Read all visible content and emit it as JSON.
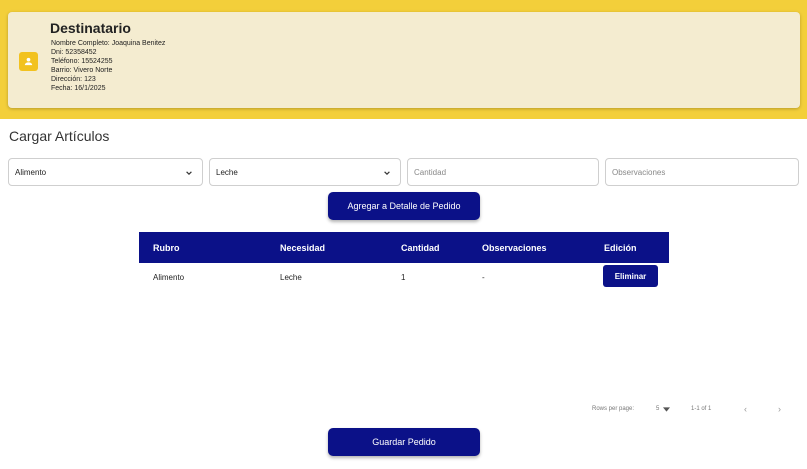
{
  "recipient": {
    "title": "Destinatario",
    "name": "Nombre Completo: Joaquina Benitez",
    "dni": "Dni: 52358452",
    "phone": "Teléfono: 15524255",
    "neighborhood": "Barrio: Vivero Norte",
    "address": "Dirección: 123",
    "date": "Fecha: 16/1/2025"
  },
  "form": {
    "section_title": "Cargar Artículos",
    "rubro_value": "Alimento",
    "necesidad_value": "Leche",
    "cantidad_placeholder": "Cantidad",
    "observaciones_placeholder": "Observaciones",
    "add_button": "Agregar a Detalle de Pedido"
  },
  "table": {
    "headers": [
      "Rubro",
      "Necesidad",
      "Cantidad",
      "Observaciones",
      "Edición"
    ],
    "rows": [
      {
        "rubro": "Alimento",
        "necesidad": "Leche",
        "cantidad": "1",
        "observaciones": "-",
        "action": "Eliminar"
      }
    ]
  },
  "pagination": {
    "rows_label": "Rows per page:",
    "rows_value": "5",
    "range": "1-1 of 1"
  },
  "footer": {
    "save_button": "Guardar Pedido"
  },
  "colors": {
    "banner": "#f3cf3a",
    "card": "#f4ecd0",
    "primary": "#0b1188"
  },
  "icons": {
    "avatar": "person-icon",
    "select": "chevron-down-icon",
    "prev": "chevron-left-icon",
    "next": "chevron-right-icon"
  }
}
